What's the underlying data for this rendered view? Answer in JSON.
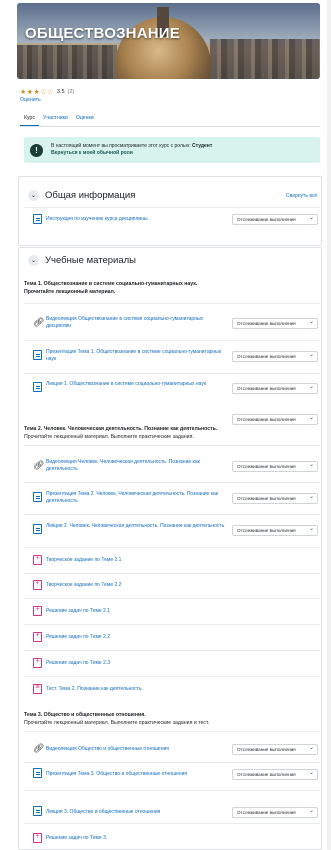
{
  "course": {
    "title": "ОБЩЕСТВОЗНАНИЕ",
    "rating_stars": "★★★☆☆",
    "rating_value": "3.5",
    "rating_count": "(2)",
    "rate_link": "Оценить"
  },
  "tabs": [
    {
      "label": "Курс",
      "active": true
    },
    {
      "label": "Участники",
      "active": false
    },
    {
      "label": "Оценки",
      "active": false
    }
  ],
  "alert": {
    "text": "В настоящий момент вы просматриваете этот курс с ролью:",
    "role": "Студент",
    "back_link": "Вернуться к моей обычной роли"
  },
  "general": {
    "title": "Общая информация",
    "collapse_all": "Свернуть всё",
    "items": [
      {
        "label": "Инструкция по изучению курса дисциплины",
        "icon": "document-icon",
        "track": "Отслеживание выполнения"
      }
    ]
  },
  "materials": {
    "title": "Учебные материалы",
    "topic1": {
      "title": "Тема 1. Обществознание в системе социально-гуманитарных наук.",
      "desc": "Прочитайте лекционный материал.",
      "items": [
        {
          "label": "Видеолекция Обществознание в системе социально-гуманитарных дисциплин",
          "icon": "link-icon",
          "track": "Отслеживание выполнения"
        },
        {
          "label": "Презентация Тема 1. Обществознание в системе социально-гуманитарных наук",
          "icon": "document-icon",
          "track": "Отслеживание выполнения"
        },
        {
          "label": "Лекция 1. Обществознание в системе социально-гуманитарных наук",
          "icon": "document-icon",
          "track": "Отслеживание выполнения"
        }
      ]
    },
    "topic2": {
      "track": "Отслеживание выполнения",
      "title": "Тема 2. Человек. Человеческая деятельность. Познание как деятельность.",
      "desc": "Прочитайте лекционный материал. Выполните практические задания.",
      "items": [
        {
          "label": "Видеолекция Человек. Человеческая деятельность. Познание как деятельность",
          "icon": "link-icon",
          "track": "Отслеживание выполнения"
        },
        {
          "label": "Презентация Тема 2. Человек. Человеческая деятельность. Познание как деятельность",
          "icon": "document-icon",
          "track": "Отслеживание выполнения"
        },
        {
          "label": "Лекция 2. Человек. Человеческая деятельность. Познание как деятельность",
          "icon": "document-icon",
          "track": "Отслеживание выполнения"
        },
        {
          "label": "Творческое задание по Теме 2.1",
          "icon": "assignment-icon"
        },
        {
          "label": "Творческое задание по Теме 2.2",
          "icon": "assignment-icon"
        },
        {
          "label": "Решение задач по Теме 2.1",
          "icon": "assignment-icon"
        },
        {
          "label": "Решение задач по Теме 2.2",
          "icon": "assignment-icon"
        },
        {
          "label": "Решение задач по Теме 2.3",
          "icon": "assignment-icon"
        },
        {
          "label": "Тест. Тема 2. Познание как деятельность.",
          "icon": "quiz-icon"
        }
      ]
    },
    "topic3": {
      "title": "Тема 3. Общество и общественные отношения.",
      "desc": "Прочитайте лекционный материал. Выполните практические задания и тест.",
      "items": [
        {
          "label": "Видеолекция Общество и общественные отношения",
          "icon": "link-icon",
          "track": "Отслеживание выполнения"
        },
        {
          "label": "Презентация Тема 3. Общество и общественные отношения",
          "icon": "document-icon",
          "track": "Отслеживание выполнения"
        },
        {
          "label": "Лекция 3. Общество и общественные отношения",
          "icon": "document-icon",
          "track": "Отслеживание выполнения"
        },
        {
          "label": "Решение задач по Теме 3.",
          "icon": "assignment-icon"
        }
      ]
    }
  }
}
